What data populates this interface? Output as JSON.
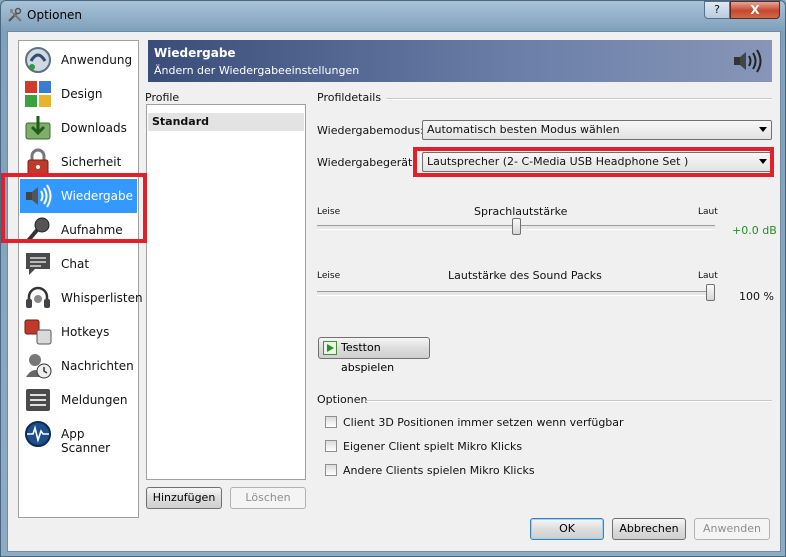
{
  "window": {
    "title": "Optionen",
    "help_label": "?",
    "close_label": "X"
  },
  "nav": {
    "items": [
      {
        "label": "Anwendung",
        "icon": "teamspeak-icon"
      },
      {
        "label": "Design",
        "icon": "design-palette-icon"
      },
      {
        "label": "Downloads",
        "icon": "downloads-icon"
      },
      {
        "label": "Sicherheit",
        "icon": "lock-icon"
      },
      {
        "label": "Wiedergabe",
        "icon": "speaker-icon",
        "selected": true
      },
      {
        "label": "Aufnahme",
        "icon": "microphone-icon"
      },
      {
        "label": "Chat",
        "icon": "chat-icon"
      },
      {
        "label": "Whisperlisten",
        "icon": "headset-icon"
      },
      {
        "label": "Hotkeys",
        "icon": "hotkeys-icon"
      },
      {
        "label": "Nachrichten",
        "icon": "messages-icon"
      },
      {
        "label": "Meldungen",
        "icon": "notifications-icon"
      },
      {
        "label": "App Scanner",
        "icon": "app-scanner-icon"
      }
    ]
  },
  "banner": {
    "title": "Wiedergabe",
    "subtitle": "Ändern der Wiedergabeeinstellungen"
  },
  "profiles": {
    "header": "Profile",
    "items": [
      "Standard"
    ],
    "add_label": "Hinzufügen",
    "delete_label": "Löschen"
  },
  "details": {
    "header": "Profildetails",
    "mode_label": "Wiedergabemodus:",
    "mode_value": "Automatisch besten Modus wählen",
    "device_label": "Wiedergabegerät:",
    "device_value": "Lautsprecher (2- C-Media USB Headphone Set  )",
    "voice": {
      "label": "Sprachlautstärke",
      "min_label": "Leise",
      "max_label": "Laut",
      "value_text": "+0.0 dB",
      "level": 0.5
    },
    "sound": {
      "label": "Lautstärke des Sound Packs",
      "min_label": "Leise",
      "max_label": "Laut",
      "value_text": "100 %",
      "level": 1.0
    },
    "test_label": "Testton abspielen"
  },
  "options": {
    "header": "Optionen",
    "items": [
      {
        "label": "Client 3D Positionen immer setzen wenn verfügbar",
        "checked": false
      },
      {
        "label": "Eigener Client spielt Mikro Klicks",
        "checked": false
      },
      {
        "label": "Andere Clients spielen Mikro Klicks",
        "checked": false
      }
    ]
  },
  "footer": {
    "ok_label": "OK",
    "cancel_label": "Abbrechen",
    "apply_label": "Anwenden"
  },
  "colors": {
    "highlight": "#e0202a",
    "selected": "#3399ff",
    "db_value": "#2a8a2a"
  }
}
